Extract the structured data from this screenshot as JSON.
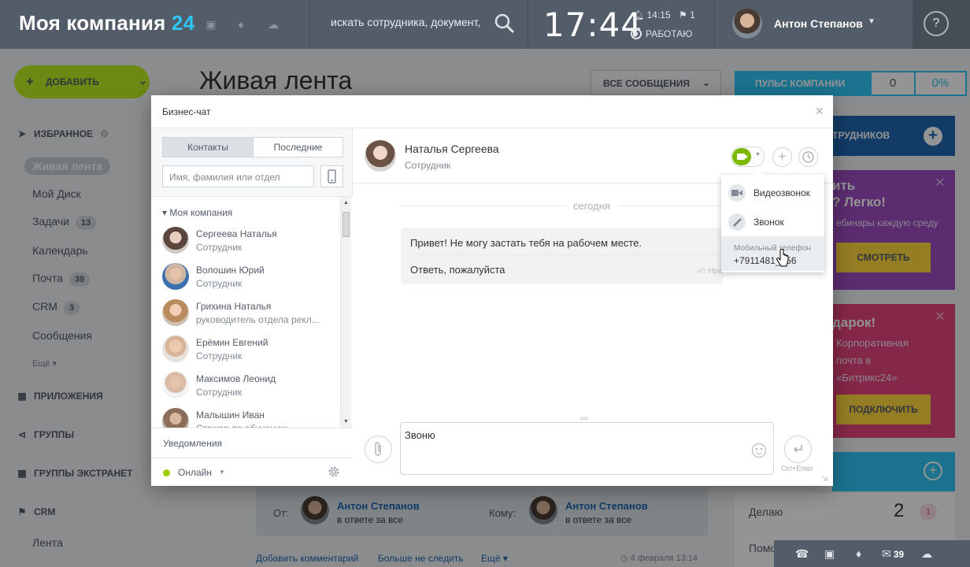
{
  "topbar": {
    "logo_text": "Моя компания",
    "logo_num": "24",
    "search_placeholder": "искать сотрудника, документ,",
    "clock": "17:44",
    "alarm_time": "14:15",
    "flag_count": "1",
    "work_status": "РАБОТАЮ",
    "user_name": "Антон Степанов",
    "help": "?"
  },
  "sidebar": {
    "add_button": "ДОБАВИТЬ",
    "favorites": "ИЗБРАННОЕ",
    "items": [
      {
        "label": "Живая лента"
      },
      {
        "label": "Мой Диск"
      },
      {
        "label": "Задачи",
        "badge": "13"
      },
      {
        "label": "Календарь"
      },
      {
        "label": "Почта",
        "badge": "39"
      },
      {
        "label": "CRM",
        "badge": "3"
      },
      {
        "label": "Сообщения"
      }
    ],
    "more": "Ещё",
    "sections": [
      "ПРИЛОЖЕНИЯ",
      "ГРУППЫ",
      "ГРУППЫ ЭКСТРАНЕТ",
      "CRM"
    ],
    "crm_feed": "Лента"
  },
  "main": {
    "title": "Живая лента",
    "filter": "ВСЕ СООБЩЕНИЯ",
    "post": {
      "from_label": "От:",
      "to_label": "Кому:",
      "from_name": "Антон Степанов",
      "from_role": "в ответе за все",
      "to_name": "Антон Степанов",
      "to_role": "в ответе за все",
      "actions": [
        "Добавить комментарий",
        "Больше не следить",
        "Ещё"
      ],
      "date": "4 февраля 13:14"
    }
  },
  "right": {
    "pulse_label": "ПУЛЬС КОМПАНИИ",
    "pulse_value": "0",
    "pulse_percent": "0%",
    "invite_label": "ТРУДНИКОВ",
    "promo1": {
      "title_1": "ить",
      "title_2": "? Легко!",
      "text": "ебинары каждую среду",
      "button": "СМОТРЕТЬ"
    },
    "promo2": {
      "title": "дарок!",
      "text_1": "Корпоративная",
      "text_2": "почта в",
      "text_3": "«Битрикс24»",
      "button": "ПОДКЛЮЧИТЬ"
    },
    "tasks_label": "Делаю",
    "tasks_count": "2",
    "tasks_badge": "1",
    "tasks_label2": "Помо",
    "mail_count": "39"
  },
  "chat": {
    "title": "Бизнес-чат",
    "tabs": [
      "Контакты",
      "Последние"
    ],
    "search_placeholder": "Имя, фамилия или отдел",
    "group": "Моя компания",
    "contacts": [
      {
        "name": "Сергеева Наталья",
        "role": "Сотрудник"
      },
      {
        "name": "Волошин Юрий",
        "role": "Сотрудник"
      },
      {
        "name": "Грихина Наталья",
        "role": "руководитель отдела рекл..."
      },
      {
        "name": "Ерёмин Евгений",
        "role": "Сотрудник"
      },
      {
        "name": "Максимов Леонид",
        "role": "Сотрудник"
      },
      {
        "name": "Малышин Иван",
        "role": "Стажер по обучению"
      }
    ],
    "notifications": "Уведомления",
    "status": "Онлайн",
    "partner_name": "Наталья Сергеева",
    "partner_role": "Сотрудник",
    "date_separator": "сегодня",
    "messages": [
      "Привет! Не могу застать тебя на рабочем месте.",
      "Ответь, пожалуйста"
    ],
    "like_label": "Нра",
    "input_text": "Звоню",
    "send_hint": "Ctrl+Enter",
    "call_menu": {
      "video": "Видеозвонок",
      "call": "Звонок",
      "mobile_title": "Мобильный телефон",
      "mobile_number": "+7911481__56"
    }
  }
}
